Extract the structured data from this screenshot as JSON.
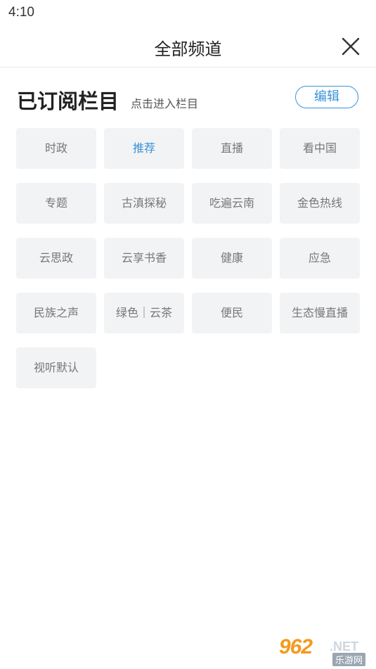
{
  "status_bar": {
    "time": "4:10"
  },
  "header": {
    "title": "全部频道",
    "close_icon": "close-icon"
  },
  "section": {
    "title": "已订阅栏目",
    "subtitle": "点击进入栏目",
    "edit_label": "编辑"
  },
  "channels": [
    {
      "label": "时政",
      "active": false
    },
    {
      "label": "推荐",
      "active": true
    },
    {
      "label": "直播",
      "active": false
    },
    {
      "label": "看中国",
      "active": false
    },
    {
      "label": "专题",
      "active": false
    },
    {
      "label": "古滇探秘",
      "active": false
    },
    {
      "label": "吃遍云南",
      "active": false
    },
    {
      "label": "金色热线",
      "active": false
    },
    {
      "label": "云思政",
      "active": false
    },
    {
      "label": "云享书香",
      "active": false
    },
    {
      "label": "健康",
      "active": false
    },
    {
      "label": "应急",
      "active": false
    },
    {
      "label": "民族之声",
      "active": false
    },
    {
      "label": "绿色｜云茶",
      "active": false
    },
    {
      "label": "便民",
      "active": false
    },
    {
      "label": "生态慢直播",
      "active": false
    },
    {
      "label": "视听默认",
      "active": false
    }
  ],
  "colors": {
    "accent": "#3a93d6",
    "chip_bg": "#f2f3f5",
    "chip_text": "#777777"
  },
  "watermark": {
    "main": "962",
    "net": ".NET",
    "sub": "乐游网"
  }
}
